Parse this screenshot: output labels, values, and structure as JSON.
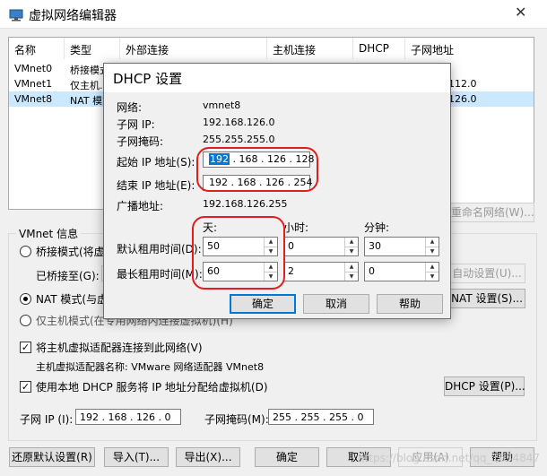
{
  "window": {
    "title": "虚拟网络编辑器",
    "close_glyph": "✕"
  },
  "network_list": {
    "columns": [
      "名称",
      "类型",
      "外部连接",
      "主机连接",
      "DHCP",
      "子网地址"
    ],
    "rows": [
      {
        "name": "VMnet0",
        "type": "桥接模式",
        "subnet": ""
      },
      {
        "name": "VMnet1",
        "type": "仅主机...",
        "subnet": "112.0"
      },
      {
        "name": "VMnet8",
        "type": "NAT 模式",
        "subnet": "126.0"
      }
    ]
  },
  "rename_button": "重命名网络(W)...",
  "vmnet_info": {
    "label": "VMnet 信息",
    "bridged": "桥接模式(将虚拟",
    "bridged_to": "已桥接至(G):",
    "auto_settings": "自动设置(U)...",
    "nat": "NAT 模式(与虚拟",
    "nat_settings": "NAT 设置(S)...",
    "host_only": "仅主机模式(在专用网络内连接虚拟机)(H)",
    "connect_adapter": "将主机虚拟适配器连接到此网络(V)",
    "adapter_name": "主机虚拟适配器名称: VMware 网络适配器 VMnet8",
    "use_dhcp": "使用本地 DHCP 服务将 IP 地址分配给虚拟机(D)",
    "dhcp_settings": "DHCP 设置(P)...",
    "subnet_ip_label": "子网 IP (I):",
    "subnet_ip": "192 . 168 . 126 . 0",
    "subnet_mask_label": "子网掩码(M):",
    "subnet_mask": "255 . 255 . 255 . 0"
  },
  "bottom_buttons": {
    "restore": "还原默认设置(R)",
    "import": "导入(T)...",
    "export": "导出(X)...",
    "ok": "确定",
    "cancel": "取消",
    "apply": "应用(A)",
    "help": "帮助"
  },
  "dhcp_dialog": {
    "title": "DHCP 设置",
    "network_label": "网络:",
    "network_value": "vmnet8",
    "subnet_ip_label": "子网 IP:",
    "subnet_ip_value": "192.168.126.0",
    "subnet_mask_label": "子网掩码:",
    "subnet_mask_value": "255.255.255.0",
    "start_ip_label": "起始 IP 地址(S):",
    "start_ip_first": "192",
    "start_ip_rest": " . 168 . 126 . 128",
    "end_ip_label": "结束 IP 地址(E):",
    "end_ip_value": "192 . 168 . 126 . 254",
    "broadcast_label": "广播地址:",
    "broadcast_value": "192.168.126.255",
    "days_label": "天:",
    "hours_label": "小时:",
    "minutes_label": "分钟:",
    "default_lease_label": "默认租用时间(D):",
    "default_lease": {
      "days": "50",
      "hours": "0",
      "minutes": "30"
    },
    "max_lease_label": "最长租用时间(M):",
    "max_lease": {
      "days": "60",
      "hours": "2",
      "minutes": "0"
    },
    "ok": "确定",
    "cancel": "取消",
    "help": "帮助"
  },
  "watermark": "https://blog.csdn.net/qq_1634847"
}
